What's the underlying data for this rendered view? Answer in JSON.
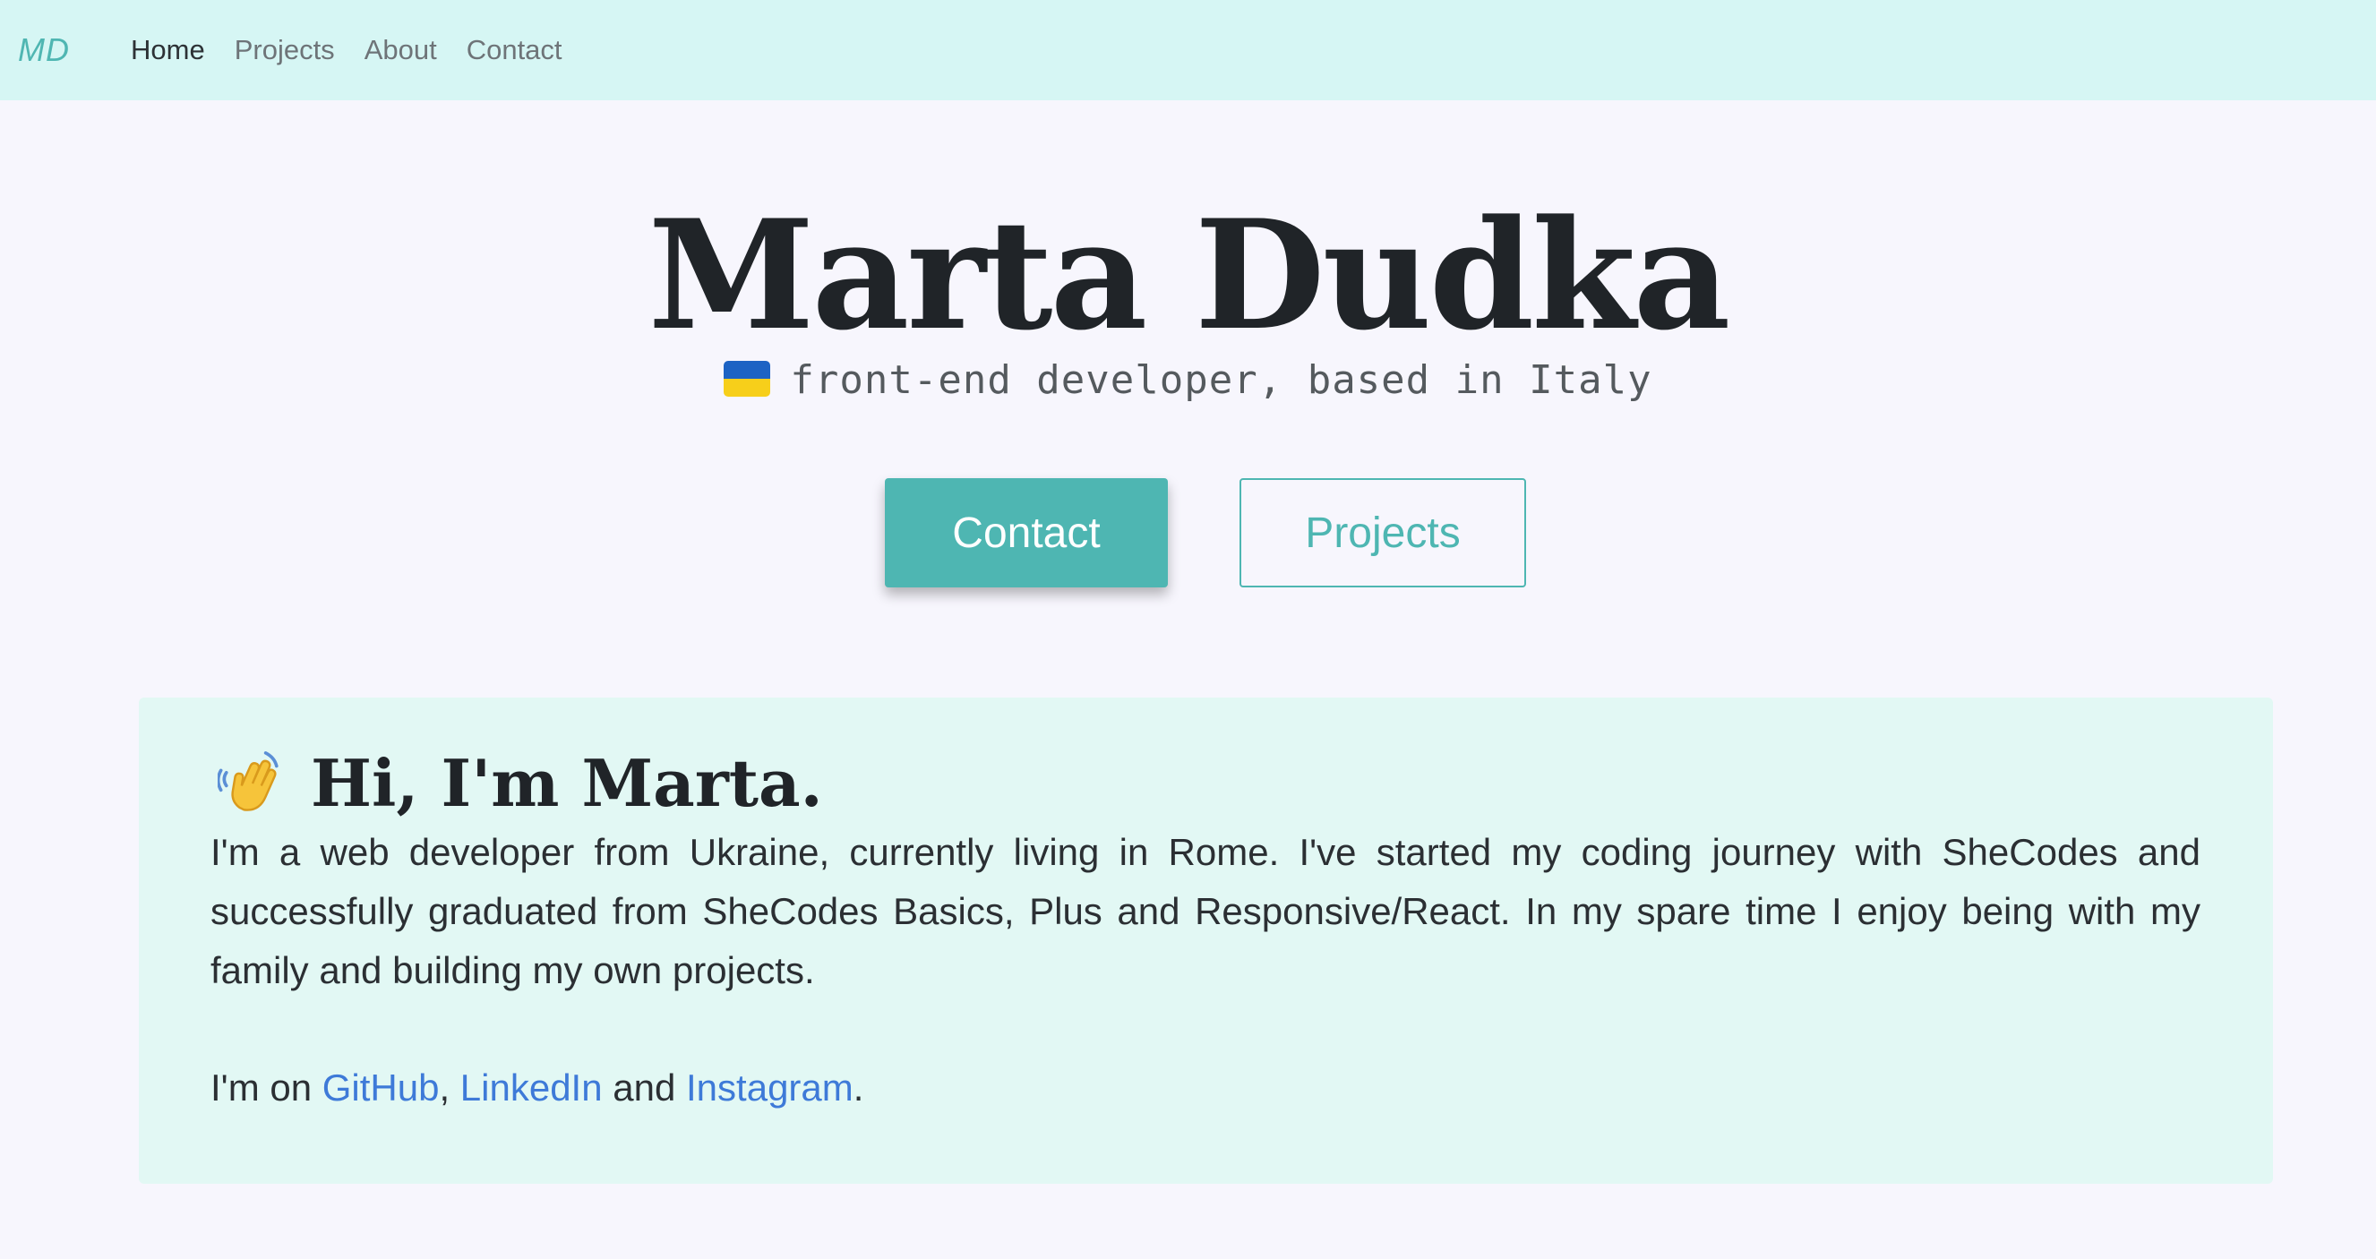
{
  "navbar": {
    "brand": "MD",
    "links": [
      {
        "label": "Home"
      },
      {
        "label": "Projects"
      },
      {
        "label": "About"
      },
      {
        "label": "Contact"
      }
    ]
  },
  "hero": {
    "title": "Marta Dudka",
    "flag_icon": "ukraine-flag-icon",
    "subtitle": "front-end developer, based in Italy",
    "buttons": {
      "contact_label": "Contact",
      "projects_label": "Projects"
    }
  },
  "about": {
    "wave_icon": "waving-hand-icon",
    "heading": "Hi, I'm Marta.",
    "paragraph": "I'm a web developer from Ukraine, currently living in Rome. I've started my coding journey with SheCodes and successfully graduated from SheCodes Basics, Plus and Responsive/React. In my spare time I enjoy being with my family and building my own projects.",
    "links_prefix": "I'm on ",
    "link_github": "GitHub",
    "sep_comma": ", ",
    "link_linkedin": "LinkedIn",
    "sep_and": " and ",
    "link_instagram": "Instagram",
    "suffix": "."
  },
  "colors": {
    "accent": "#4eb6b2",
    "navbar_bg": "#d6f6f4",
    "page_bg": "#f7f6fd",
    "card_bg": "#e2f8f4",
    "link": "#3e7ad8"
  }
}
